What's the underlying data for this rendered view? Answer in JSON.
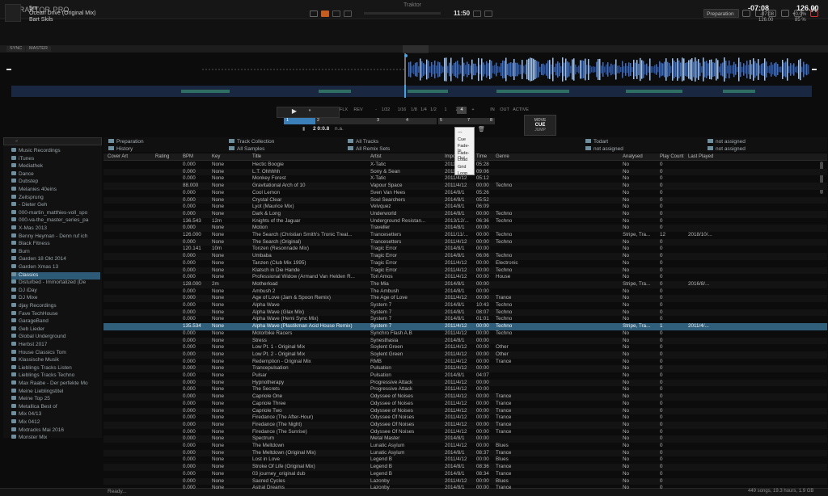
{
  "window": {
    "title": "Traktor",
    "brand": "TRAKTOR",
    "brand_sub": "PRO",
    "clock": "11:50",
    "layout": "Preparation"
  },
  "deck": {
    "letter": "A",
    "title": "5m",
    "subtitle": "Ocean Drive (Original Mix)",
    "artist": "Bart Skils",
    "time": "-07:08",
    "bpm": "126.00",
    "time2": "-07:08",
    "pitch": "+0.0%",
    "time3": "126.00",
    "keylock": "85 %",
    "sync_label": "SYNC",
    "master_label": "MASTER"
  },
  "transport": {
    "loop_sizes": [
      "1/32",
      "1/16",
      "1/8",
      "1/4",
      "1/2",
      "1",
      "2",
      "4"
    ],
    "beat_pos": "2 0:0.8",
    "beat_na": "n.a.",
    "hotcues": [
      "1",
      "2",
      "3",
      "4",
      "5",
      "6",
      "7",
      "8"
    ],
    "cue_box": {
      "label": "MOVE",
      "value": "CUE",
      "sub": "JUMP"
    },
    "buttons": [
      "FLX",
      "REV",
      "IN",
      "OUT",
      "ACTIVE"
    ],
    "stepper_minus": "-",
    "stepper_plus": "+"
  },
  "context_menu": [
    "---",
    "Cue",
    "Fade-In",
    "Fade-Out",
    "Load",
    "Grid",
    "Loop"
  ],
  "search": {
    "placeholder": ""
  },
  "sidebar": [
    {
      "label": "Music Recordings",
      "sel": false
    },
    {
      "label": "iTunes",
      "sel": false
    },
    {
      "label": "Mediathek",
      "sel": false
    },
    {
      "label": "Dance",
      "sel": false
    },
    {
      "label": "Dubstep",
      "sel": false
    },
    {
      "label": "Melanies 40eins",
      "sel": false
    },
    {
      "label": "Zeitsprung",
      "sel": false
    },
    {
      "label": "- Dieter Geh",
      "sel": false
    },
    {
      "label": "000-martin_matthies-voll_spo",
      "sel": false
    },
    {
      "label": "000-va-the_master_series_pa",
      "sel": false
    },
    {
      "label": "X-Mas 2013",
      "sel": false
    },
    {
      "label": "Benny Heyman - Denn ruf ich",
      "sel": false
    },
    {
      "label": "Black Fitness",
      "sel": false
    },
    {
      "label": "Burn",
      "sel": false
    },
    {
      "label": "Garden 18 Okt 2014",
      "sel": false
    },
    {
      "label": "Garden Xmas 13",
      "sel": false
    },
    {
      "label": "Classics",
      "sel": true
    },
    {
      "label": "Disturbed - Immortalized (De",
      "sel": false
    },
    {
      "label": "DJ iDay",
      "sel": false
    },
    {
      "label": "DJ Mixe",
      "sel": false
    },
    {
      "label": "djay Recordings",
      "sel": false
    },
    {
      "label": "Fave TechHouse",
      "sel": false
    },
    {
      "label": "GarageBand",
      "sel": false
    },
    {
      "label": "Geb Lieder",
      "sel": false
    },
    {
      "label": "Global Underground",
      "sel": false
    },
    {
      "label": "Herbst 2017",
      "sel": false
    },
    {
      "label": "House Classics Tom",
      "sel": false
    },
    {
      "label": "Klassische Musik",
      "sel": false
    },
    {
      "label": "Lieblings Tracks Listen",
      "sel": false
    },
    {
      "label": "Lieblings Tracks Techno",
      "sel": false
    },
    {
      "label": "Max Raabe - Der perfekte Mo",
      "sel": false
    },
    {
      "label": "Meine Lieblingstitel",
      "sel": false
    },
    {
      "label": "Meine Top 25",
      "sel": false
    },
    {
      "label": "Metallica Best of",
      "sel": false
    },
    {
      "label": "Mix 04/13",
      "sel": false
    },
    {
      "label": "Mix 0412",
      "sel": false
    },
    {
      "label": "Mixtracks Mai 2016",
      "sel": false
    },
    {
      "label": "Monster Mix",
      "sel": false
    }
  ],
  "favorites": [
    {
      "label": "Preparation"
    },
    {
      "label": "Track Collection"
    },
    {
      "label": "All Tracks"
    },
    {
      "label": "Todart"
    },
    {
      "label": "not assigned"
    },
    {
      "label": "History"
    },
    {
      "label": "All Samples"
    },
    {
      "label": "All Remix Sets"
    },
    {
      "label": "not assigned"
    },
    {
      "label": "not assigned"
    }
  ],
  "columns": [
    "Cover Art",
    "Rating",
    "BPM",
    "Key",
    "Title",
    "Artist",
    "Import Date",
    "Time",
    "Genre",
    "Analysed",
    "Play Count",
    "Last Played"
  ],
  "rows": [
    [
      "",
      "0.000",
      "None",
      "Hectic Boogie",
      "X-Tatic",
      "2011/4/12",
      "05:28",
      "",
      "No",
      "0",
      ""
    ],
    [
      "",
      "0.000",
      "None",
      "L.T. Ohhhhh",
      "Sony & Sean",
      "2011/4/12",
      "09:06",
      "",
      "No",
      "0",
      ""
    ],
    [
      "",
      "0.000",
      "None",
      "Monkey Forest",
      "X-Tatic",
      "2011/4/12",
      "05:12",
      "",
      "No",
      "0",
      ""
    ],
    [
      "",
      "88.000",
      "None",
      "Gravitational Arch of 10",
      "Vapour Space",
      "2011/4/12",
      "00:00",
      "Techno",
      "No",
      "0",
      ""
    ],
    [
      "",
      "0.000",
      "None",
      "Cool Lemon",
      "Sven Van Hees",
      "2014/8/1",
      "05:26",
      "",
      "No",
      "0",
      ""
    ],
    [
      "",
      "0.000",
      "None",
      "Crystal Clear",
      "Soul Searchers",
      "2014/8/1",
      "05:52",
      "",
      "No",
      "0",
      ""
    ],
    [
      "",
      "0.000",
      "None",
      "Lyot (Maurice Mix)",
      "Velvquez",
      "2014/8/1",
      "06:09",
      "",
      "No",
      "0",
      ""
    ],
    [
      "",
      "0.000",
      "None",
      "Dark & Long",
      "Underworld",
      "2014/8/1",
      "00:00",
      "Techno",
      "No",
      "0",
      ""
    ],
    [
      "",
      "136.543",
      "12m",
      "Knights of the Jaguar",
      "Underground Resistan...",
      "2013/12/...",
      "06:36",
      "Techno",
      "No",
      "0",
      ""
    ],
    [
      "",
      "0.000",
      "None",
      "Motion",
      "Traveller",
      "2014/8/1",
      "00:00",
      "",
      "No",
      "0",
      ""
    ],
    [
      "",
      "126.000",
      "None",
      "The Search (Christian Smith's Tronic Treat...",
      "Trancesetters",
      "2011/11/...",
      "00:00",
      "Techno",
      "Stripe, Tra...",
      "12",
      "2018/10/..."
    ],
    [
      "",
      "0.000",
      "None",
      "The Search (Original)",
      "Trancesetters",
      "2011/4/12",
      "00:00",
      "Techno",
      "No",
      "0",
      ""
    ],
    [
      "",
      "120.141",
      "10m",
      "Tonzen (Resonnade Mix)",
      "Tragic Error",
      "2014/8/1",
      "00:00",
      "",
      "No",
      "0",
      ""
    ],
    [
      "",
      "0.000",
      "None",
      "Umbaba",
      "Tragic Error",
      "2014/8/1",
      "06:06",
      "Techno",
      "No",
      "0",
      ""
    ],
    [
      "",
      "0.000",
      "None",
      "Tanzen (Club Mix 1995)",
      "Tragic Error",
      "2011/4/12",
      "00:00",
      "Electronic",
      "No",
      "0",
      ""
    ],
    [
      "",
      "0.000",
      "None",
      "Klatsch in Die Hande",
      "Tragic Error",
      "2011/4/12",
      "00:00",
      "Techno",
      "No",
      "0",
      ""
    ],
    [
      "",
      "0.000",
      "None",
      "Professional Widow (Armand Van Helden R...",
      "Tori Amos",
      "2011/4/12",
      "00:00",
      "House",
      "No",
      "0",
      ""
    ],
    [
      "",
      "128.000",
      "2m",
      "Motherload",
      "The Mia",
      "2014/8/1",
      "00:00",
      "",
      "Stripe, Tra...",
      "0",
      "2016/8/..."
    ],
    [
      "",
      "0.000",
      "None",
      "Ambush 2",
      "The Ambush",
      "2014/8/1",
      "00:00",
      "",
      "No",
      "0",
      ""
    ],
    [
      "",
      "0.000",
      "None",
      "Age of Love (Jam & Spoon Remix)",
      "The Age of Love",
      "2011/4/12",
      "00:00",
      "Trance",
      "No",
      "0",
      ""
    ],
    [
      "",
      "0.000",
      "None",
      "Alpha Wave",
      "System 7",
      "2014/8/1",
      "10:43",
      "Techno",
      "No",
      "0",
      ""
    ],
    [
      "",
      "0.000",
      "None",
      "Alpha Wave (Glax Mix)",
      "System 7",
      "2014/8/1",
      "08:07",
      "Techno",
      "No",
      "0",
      ""
    ],
    [
      "",
      "0.000",
      "None",
      "Alpha Wave (Hemi Sync Mix)",
      "System 7",
      "2014/8/1",
      "01:01",
      "Techno",
      "No",
      "0",
      ""
    ],
    [
      "",
      "135.534",
      "None",
      "Alpha Wave (Plastikman Acid House Remix)",
      "System 7",
      "2011/4/12",
      "00:00",
      "Techno",
      "Stripe, Tra...",
      "1",
      "2011/4/..."
    ],
    [
      "",
      "0.000",
      "None",
      "Motorbike Racers",
      "Synchro Flash A.B",
      "2011/4/12",
      "00:00",
      "Techno",
      "No",
      "0",
      ""
    ],
    [
      "",
      "0.000",
      "None",
      "Stress",
      "Synesthasia",
      "2014/8/1",
      "00:00",
      "",
      "No",
      "0",
      ""
    ],
    [
      "",
      "0.000",
      "None",
      "Low Pt. 1 - Original Mix",
      "Soylent Green",
      "2011/4/12",
      "00:00",
      "Other",
      "No",
      "0",
      ""
    ],
    [
      "",
      "0.000",
      "None",
      "Low Pt. 2 - Original Mix",
      "Soylent Green",
      "2011/4/12",
      "00:00",
      "Other",
      "No",
      "0",
      ""
    ],
    [
      "",
      "0.000",
      "None",
      "Redemption - Original Mix",
      "RMB",
      "2011/4/12",
      "00:00",
      "Trance",
      "No",
      "0",
      ""
    ],
    [
      "",
      "0.000",
      "None",
      "Trancepulsation",
      "Pulsation",
      "2011/4/12",
      "00:00",
      "",
      "No",
      "0",
      ""
    ],
    [
      "",
      "0.000",
      "None",
      "Pulsar",
      "Pulsation",
      "2014/8/1",
      "04:07",
      "",
      "No",
      "0",
      ""
    ],
    [
      "",
      "0.000",
      "None",
      "Hypnotherapy",
      "Progressive Attack",
      "2011/4/12",
      "00:00",
      "",
      "No",
      "0",
      ""
    ],
    [
      "",
      "0.000",
      "None",
      "The Secrets",
      "Progressive Attack",
      "2011/4/12",
      "00:00",
      "",
      "No",
      "0",
      ""
    ],
    [
      "",
      "0.000",
      "None",
      "Capriole One",
      "Odyssee of Noises",
      "2011/4/12",
      "00:00",
      "Trance",
      "No",
      "0",
      ""
    ],
    [
      "",
      "0.000",
      "None",
      "Capriole Three",
      "Odyssee of Noises",
      "2011/4/12",
      "00:00",
      "Trance",
      "No",
      "0",
      ""
    ],
    [
      "",
      "0.000",
      "None",
      "Capriole Two",
      "Odyssee of Noises",
      "2011/4/12",
      "00:00",
      "Trance",
      "No",
      "0",
      ""
    ],
    [
      "",
      "0.000",
      "None",
      "Firedance (The After-Hour)",
      "Odyssee Of Noises",
      "2011/4/12",
      "00:00",
      "Trance",
      "No",
      "0",
      ""
    ],
    [
      "",
      "0.000",
      "None",
      "Firedance (The Night)",
      "Odyssee Of Noises",
      "2011/4/12",
      "00:00",
      "Trance",
      "No",
      "0",
      ""
    ],
    [
      "",
      "0.000",
      "None",
      "Firedance (The Sunrise)",
      "Odyssee Of Noises",
      "2011/4/12",
      "00:00",
      "Trance",
      "No",
      "0",
      ""
    ],
    [
      "",
      "0.000",
      "None",
      "Spectrum",
      "Metal Master",
      "2014/8/1",
      "00:00",
      "",
      "No",
      "0",
      ""
    ],
    [
      "",
      "0.000",
      "None",
      "The Meltdown",
      "Lunatic Asylum",
      "2011/4/12",
      "00:00",
      "Blues",
      "No",
      "0",
      ""
    ],
    [
      "",
      "0.000",
      "None",
      "The Meltdown (Original Mix)",
      "Lunatic Asylum",
      "2014/8/1",
      "08:37",
      "Trance",
      "No",
      "0",
      ""
    ],
    [
      "",
      "0.000",
      "None",
      "Lost in Love",
      "Legend B",
      "2011/4/12",
      "00:00",
      "Blues",
      "No",
      "0",
      ""
    ],
    [
      "",
      "0.000",
      "None",
      "Stroke Of Life (Original Mix)",
      "Legend B",
      "2014/8/1",
      "08:36",
      "Trance",
      "No",
      "0",
      ""
    ],
    [
      "",
      "0.000",
      "None",
      "03 journey_original dub",
      "Legend B",
      "2014/8/1",
      "08:34",
      "Trance",
      "No",
      "0",
      ""
    ],
    [
      "",
      "0.000",
      "None",
      "Sacred Cycles",
      "Lazonby",
      "2011/4/12",
      "00:00",
      "Blues",
      "No",
      "0",
      ""
    ],
    [
      "",
      "0.000",
      "None",
      "Astral Dreams",
      "Lazonby",
      "2014/8/1",
      "00:00",
      "Trance",
      "No",
      "0",
      ""
    ]
  ],
  "status": {
    "left": "Ready...",
    "right": "449 songs, 19.3 hours, 1.9 GB"
  }
}
